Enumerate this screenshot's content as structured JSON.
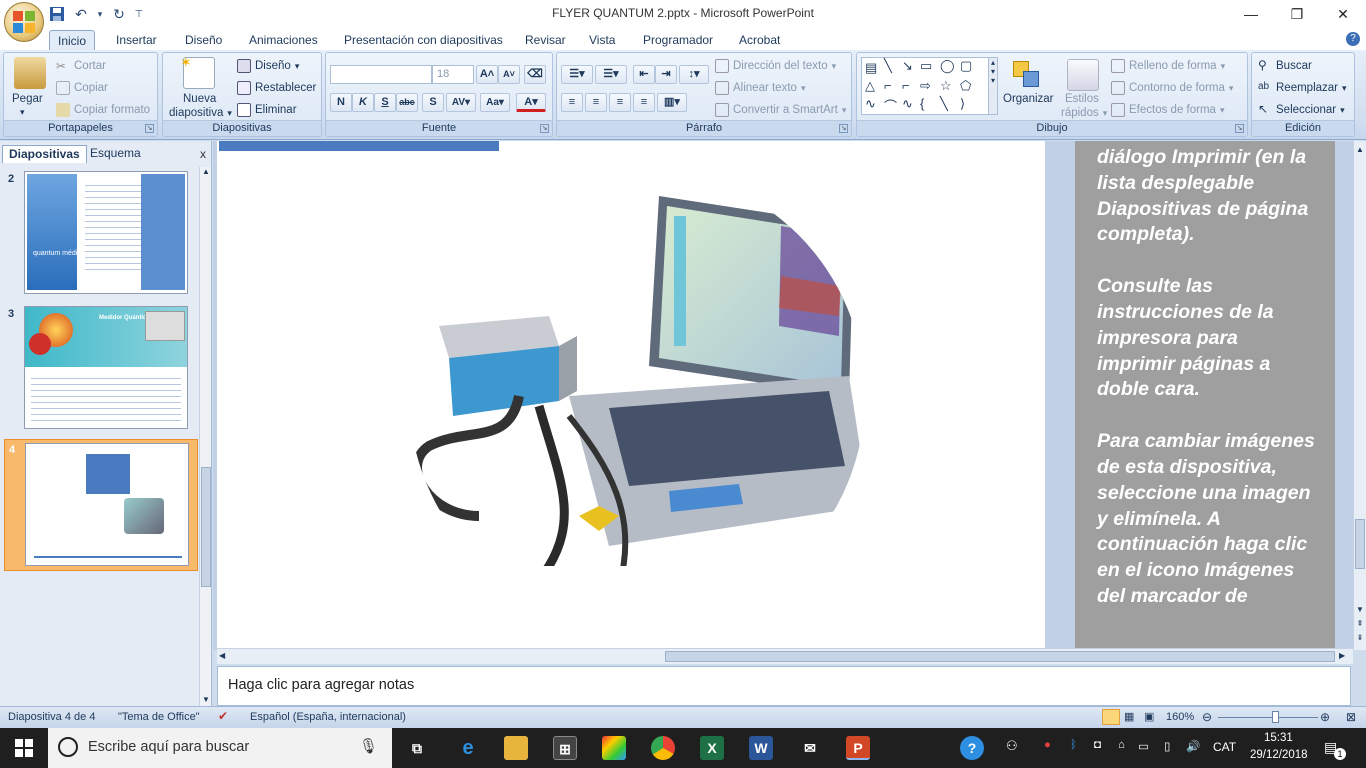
{
  "window": {
    "title": "FLYER QUANTUM 2.pptx - Microsoft PowerPoint",
    "minimize": "—",
    "restore": "❐",
    "close": "✕"
  },
  "qat": {
    "save": "save-icon",
    "undo": "undo-icon",
    "redo": "redo-icon",
    "customize": "▾"
  },
  "tabs": [
    "Inicio",
    "Insertar",
    "Diseño",
    "Animaciones",
    "Presentación con diapositivas",
    "Revisar",
    "Vista",
    "Programador",
    "Acrobat"
  ],
  "ribbon": {
    "portapapeles": {
      "label": "Portapapeles",
      "paste": "Pegar",
      "cut": "Cortar",
      "copy": "Copiar",
      "format_painter": "Copiar formato"
    },
    "diapositivas": {
      "label": "Diapositivas",
      "new_slide_1": "Nueva",
      "new_slide_2": "diapositiva",
      "layout": "Diseño",
      "reset": "Restablecer",
      "delete": "Eliminar"
    },
    "fuente": {
      "label": "Fuente",
      "font_name": "",
      "font_size": "18"
    },
    "parrafo": {
      "label": "Párrafo",
      "text_direction": "Dirección del texto",
      "align_text": "Alinear texto",
      "smartart": "Convertir a SmartArt"
    },
    "dibujo": {
      "label": "Dibujo",
      "arrange": "Organizar",
      "quick_styles_1": "Estilos",
      "quick_styles_2": "rápidos",
      "shape_fill": "Relleno de forma",
      "shape_outline": "Contorno de forma",
      "shape_effects": "Efectos de forma"
    },
    "edicion": {
      "label": "Edición",
      "find": "Buscar",
      "replace": "Reemplazar",
      "select": "Seleccionar"
    }
  },
  "slides_pane": {
    "tab_slides": "Diapositivas",
    "tab_outline": "Esquema",
    "slides": [
      {
        "number": "2",
        "thumb_title": "quantum médical"
      },
      {
        "number": "3",
        "thumb_title": "Medidor Quántico"
      },
      {
        "number": "4",
        "thumb_title": ""
      }
    ]
  },
  "slide": {
    "sidebar_paragraphs": [
      "diálogo Imprimir (en la lista desplegable Diapositivas de página completa).",
      "Consulte las instrucciones de la impresora para imprimir páginas a doble cara.",
      "Para cambiar imágenes de esta dispositiva, seleccione una imagen y elimínela. A continuación haga clic en el icono Imágenes del marcador de"
    ]
  },
  "notes": {
    "placeholder": "Haga clic para agregar notas"
  },
  "status": {
    "slide_info": "Diapositiva 4 de 4",
    "theme": "\"Tema de Office\"",
    "language": "Español (España, internacional)",
    "zoom": "160%"
  },
  "taskbar": {
    "search_placeholder": "Escribe aquí para buscar",
    "lang": "CAT",
    "time": "15:31",
    "date": "29/12/2018",
    "notification_count": "1"
  },
  "colors": {
    "accent": "#4a7bc0",
    "ribbon_bg": "#dce7f5",
    "sidebar_bg": "#9f9f9f",
    "selected_slide": "#f9b96a"
  }
}
